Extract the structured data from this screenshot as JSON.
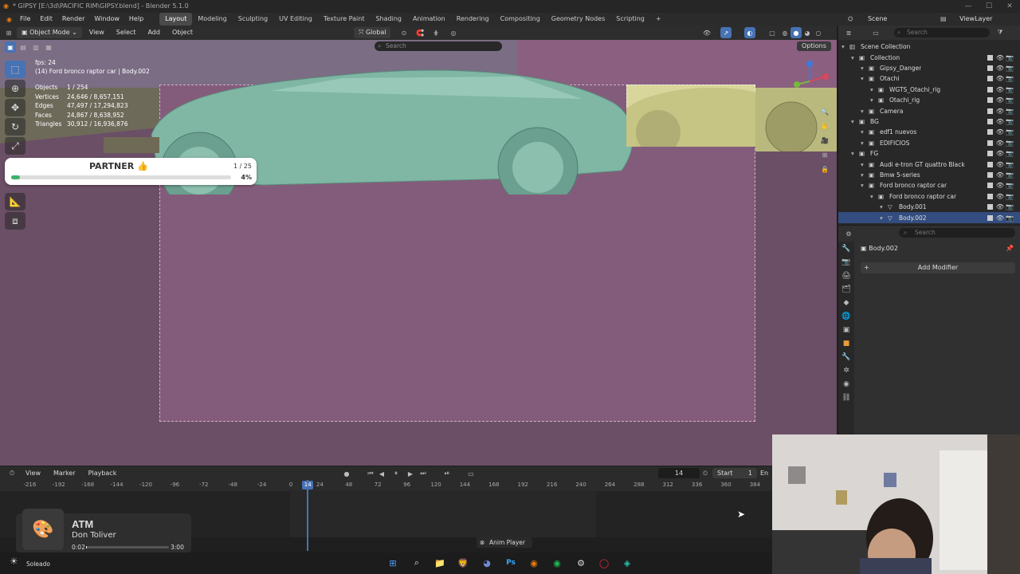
{
  "window": {
    "title": "* GIPSY [E:\\3d\\PACIFIC RIM\\GIPSY.blend] - Blender 5.1.0"
  },
  "menu": [
    "File",
    "Edit",
    "Render",
    "Window",
    "Help"
  ],
  "workspaces": [
    "Layout",
    "Modeling",
    "Sculpting",
    "UV Editing",
    "Texture Paint",
    "Shading",
    "Animation",
    "Rendering",
    "Compositing",
    "Geometry Nodes",
    "Scripting"
  ],
  "scene": {
    "label": "Scene",
    "viewlayer": "ViewLayer"
  },
  "viewport_header": {
    "mode": "Object Mode",
    "menus": [
      "View",
      "Select",
      "Add",
      "Object"
    ],
    "orientation": "Global",
    "search_placeholder": "Search",
    "options": "Options"
  },
  "overlay": {
    "fps": "fps: 24",
    "object": "(14) Ford bronco raptor car | Body.002"
  },
  "stats": [
    {
      "k": "Objects",
      "v": "1 / 254"
    },
    {
      "k": "Vertices",
      "v": "24,646 / 8,657,151"
    },
    {
      "k": "Edges",
      "v": "47,497 / 17,294,823"
    },
    {
      "k": "Faces",
      "v": "24,867 / 8,638,952"
    },
    {
      "k": "Triangles",
      "v": "30,912 / 16,936,876"
    }
  ],
  "partner": {
    "title": "PARTNER",
    "emoji": "👍",
    "count": "1 / 25",
    "percent": "4%",
    "progress": 0.04
  },
  "outliner": {
    "search_placeholder": "Search",
    "items": [
      {
        "label": "Scene Collection",
        "indent": 0
      },
      {
        "label": "Collection",
        "indent": 1
      },
      {
        "label": "Gipsy_Danger",
        "indent": 2
      },
      {
        "label": "Otachi",
        "indent": 2
      },
      {
        "label": "WGTS_Otachi_rig",
        "indent": 3
      },
      {
        "label": "Otachi_rig",
        "indent": 3
      },
      {
        "label": "Camera",
        "indent": 2
      },
      {
        "label": "BG",
        "indent": 1
      },
      {
        "label": "edf1 nuevos",
        "indent": 2
      },
      {
        "label": "EDIFICIOS",
        "indent": 2
      },
      {
        "label": "FG",
        "indent": 1
      },
      {
        "label": "Audi e-tron GT quattro Black",
        "indent": 2
      },
      {
        "label": "Bmw 5-series",
        "indent": 2
      },
      {
        "label": "Ford bronco raptor car",
        "indent": 2
      },
      {
        "label": "Ford bronco raptor car",
        "indent": 3
      },
      {
        "label": "Body.001",
        "indent": 4
      },
      {
        "label": "Body.002",
        "indent": 4,
        "selected": true
      }
    ]
  },
  "properties": {
    "search_placeholder": "Search",
    "object": "Body.002",
    "add_modifier": "Add Modifier"
  },
  "timeline": {
    "menus": [
      "View",
      "Marker",
      "Playback"
    ],
    "current_frame": "14",
    "start_label": "Start",
    "start_value": "1",
    "end_label": "En",
    "ticks": [
      "-216",
      "-192",
      "-168",
      "-144",
      "-120",
      "-96",
      "-72",
      "-48",
      "-24",
      "0",
      "24",
      "48",
      "72",
      "96",
      "120",
      "144",
      "168",
      "192",
      "216",
      "240",
      "264",
      "288",
      "312",
      "336",
      "360",
      "384"
    ]
  },
  "media": {
    "title": "ATM",
    "artist": "Don Toliver",
    "elapsed": "0:02",
    "duration": "3:00",
    "progress": 0.011
  },
  "weather": "Soleado",
  "anim_player": "Anim Player"
}
